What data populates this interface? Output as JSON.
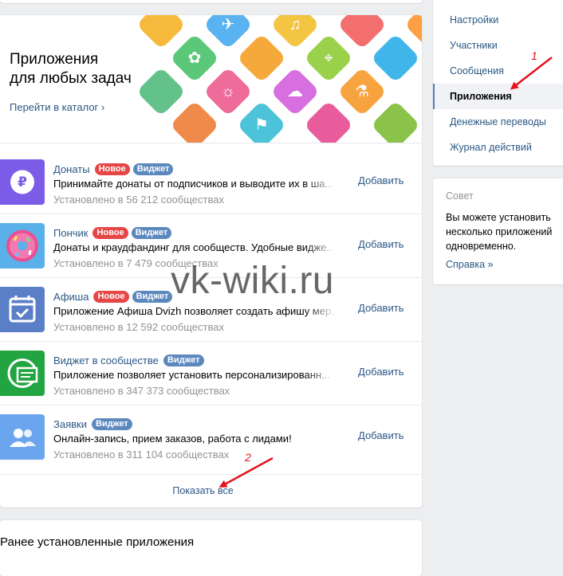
{
  "banner": {
    "title": "Приложения\nдля любых задач",
    "catalog_link": "Перейти в каталог ›"
  },
  "apps": [
    {
      "name": "Донаты",
      "badges": [
        "Новое",
        "Виджет"
      ],
      "description": "Принимайте донаты от подписчиков и выводите их в ша...",
      "installed": "Установлено в 56 212 сообществах",
      "action": "Добавить",
      "icon_color": "#7a5ce6",
      "icon": "ruble-icon"
    },
    {
      "name": "Пончик",
      "badges": [
        "Новое",
        "Виджет"
      ],
      "description": "Донаты и краудфандинг для сообществ. Удобные видже...",
      "installed": "Установлено в 7 479 сообществах",
      "action": "Добавить",
      "icon_color": "#5ab0e8",
      "icon": "donut-icon"
    },
    {
      "name": "Афиша",
      "badges": [
        "Новое",
        "Виджет"
      ],
      "description": "Приложение Афиша Dvizh позволяет создать афишу мер...",
      "installed": "Установлено в 12 592 сообществах",
      "action": "Добавить",
      "icon_color": "#5b7fc7",
      "icon": "calendar-icon"
    },
    {
      "name": "Виджет в сообществе",
      "badges": [
        "Виджет"
      ],
      "description": "Приложение позволяет установить персонализированн...",
      "installed": "Установлено в 347 373 сообществах",
      "action": "Добавить",
      "icon_color": "#22a441",
      "icon": "globe-widget-icon"
    },
    {
      "name": "Заявки",
      "badges": [
        "Виджет"
      ],
      "description": "Онлайн-запись, прием заказов, работа с лидами!",
      "installed": "Установлено в 311 104 сообществах",
      "action": "Добавить",
      "icon_color": "#6aa5ee",
      "icon": "users-icon"
    }
  ],
  "show_all": "Показать все",
  "previously_installed": "Ранее установленные приложения",
  "menu": {
    "items": [
      "Настройки",
      "Участники",
      "Сообщения",
      "Приложения",
      "Денежные переводы",
      "Журнал действий"
    ],
    "active": "Приложения"
  },
  "tip": {
    "title": "Совет",
    "text": "Вы можете установить несколько приложений одновременно.",
    "help_link": "Справка »"
  },
  "annotations": {
    "watermark": "vk-wiki.ru",
    "arrow1_label": "1",
    "arrow2_label": "2",
    "arrow_color": "#e3141d"
  },
  "colors": {
    "link": "#2a5885",
    "badge_new": "#e64646",
    "badge_widget": "#5b88bd",
    "background": "#edeef0"
  }
}
